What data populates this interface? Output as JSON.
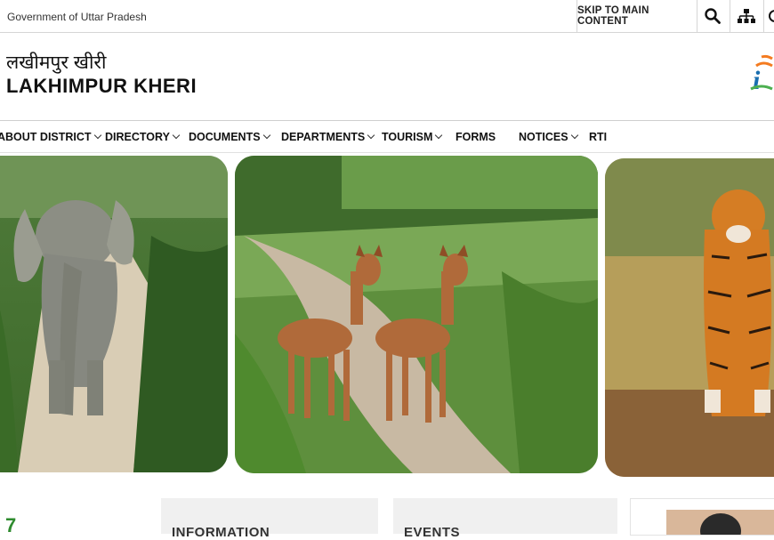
{
  "topbar": {
    "gov_label": "Government of Uttar Pradesh",
    "skip_label": "SKIP TO MAIN CONTENT",
    "icons": [
      "search-icon",
      "sitemap-icon",
      "accessibility-icon"
    ]
  },
  "header": {
    "title_hindi": "लखीमपुर खीरी",
    "title_english": "LAKHIMPUR KHERI"
  },
  "nav": {
    "items": [
      {
        "label": "ABOUT DISTRICT",
        "dropdown": true
      },
      {
        "label": "DIRECTORY",
        "dropdown": true
      },
      {
        "label": "DOCUMENTS",
        "dropdown": true
      },
      {
        "label": "DEPARTMENTS",
        "dropdown": true
      },
      {
        "label": "TOURISM",
        "dropdown": true
      },
      {
        "label": "FORMS",
        "dropdown": false
      },
      {
        "label": "NOTICES",
        "dropdown": true
      },
      {
        "label": "RTI",
        "dropdown": false
      }
    ]
  },
  "slider": {
    "slides": [
      "elephant",
      "deer",
      "tiger"
    ]
  },
  "bottom": {
    "counter": "7",
    "panel1_title": "INFORMATION",
    "panel2_title": "EVENTS"
  },
  "colors": {
    "accent_green": "#2e8b2e",
    "text": "#111111"
  }
}
